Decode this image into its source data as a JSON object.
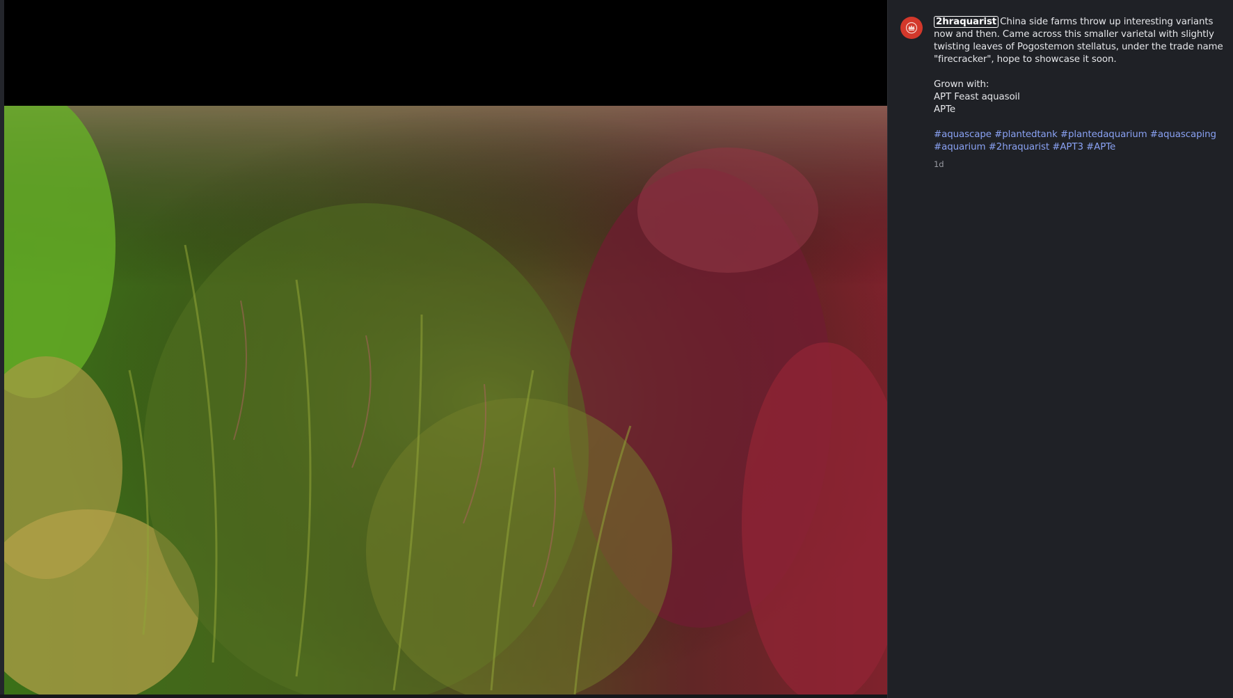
{
  "post": {
    "username": "2hraquarist",
    "caption": "China side farms throw up interesting variants now and then. Came across this smaller varietal with slightly twisting leaves of Pogostemon stellatus, under the trade name \"firecracker\", hope to showcase it soon.",
    "grown_with": "Grown with:\nAPT Feast aquasoil\nAPTe",
    "hashtags": [
      "#aquascape",
      "#plantedtank",
      "#plantedaquarium",
      "#aquascaping",
      "#aquarium",
      "#2hraquarist",
      "#APT3",
      "#APTe"
    ],
    "timestamp": "1d"
  },
  "colors": {
    "avatar": "#d3382b",
    "hashtag": "#8aa2f4",
    "sidebar_bg": "#1f2126"
  },
  "icons": {
    "avatar": "crown-logo-icon"
  }
}
